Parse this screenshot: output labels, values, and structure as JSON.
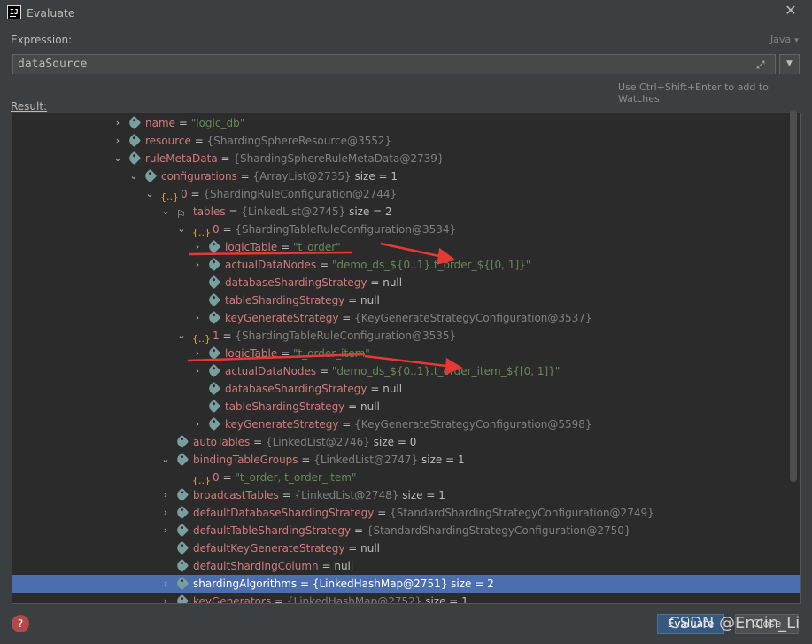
{
  "window": {
    "title": "Evaluate",
    "app_icon_text": "IJ"
  },
  "expression": {
    "label": "Expression:",
    "language": "Java",
    "value": "dataSource",
    "hint": "Use Ctrl+Shift+Enter to add to Watches"
  },
  "result_label": "Result:",
  "tree_rows": [
    {
      "name": "name",
      "eq": " = ",
      "type": "",
      "string": "\"logic_db\"",
      "extra": ""
    },
    {
      "name": "resource",
      "eq": " = ",
      "type": "{ShardingSphereResource@3552}",
      "string": "",
      "extra": ""
    },
    {
      "name": "ruleMetaData",
      "eq": " = ",
      "type": "{ShardingSphereRuleMetaData@2739}",
      "string": "",
      "extra": ""
    },
    {
      "name": "configurations",
      "eq": " = ",
      "type": "{ArrayList@2735}",
      "string": "",
      "extra": "  size = 1"
    },
    {
      "name": "0",
      "eq": " = ",
      "type": "{ShardingRuleConfiguration@2744}",
      "string": "",
      "extra": ""
    },
    {
      "name": "tables",
      "eq": " = ",
      "type": "{LinkedList@2745}",
      "string": "",
      "extra": "  size = 2"
    },
    {
      "name": "0",
      "eq": " = ",
      "type": "{ShardingTableRuleConfiguration@3534}",
      "string": "",
      "extra": ""
    },
    {
      "name": "logicTable",
      "eq": " = ",
      "type": "",
      "string": "\"t_order\"",
      "extra": ""
    },
    {
      "name": "actualDataNodes",
      "eq": " = ",
      "type": "",
      "string": "\"demo_ds_${0..1}.t_order_${[0, 1]}\"",
      "extra": ""
    },
    {
      "name": "databaseShardingStrategy",
      "eq": " = ",
      "type": "",
      "string": "",
      "extra": "null"
    },
    {
      "name": "tableShardingStrategy",
      "eq": " = ",
      "type": "",
      "string": "",
      "extra": "null"
    },
    {
      "name": "keyGenerateStrategy",
      "eq": " = ",
      "type": "{KeyGenerateStrategyConfiguration@3537}",
      "string": "",
      "extra": ""
    },
    {
      "name": "1",
      "eq": " = ",
      "type": "{ShardingTableRuleConfiguration@3535}",
      "string": "",
      "extra": ""
    },
    {
      "name": "logicTable",
      "eq": " = ",
      "type": "",
      "string": "\"t_order_item\"",
      "extra": ""
    },
    {
      "name": "actualDataNodes",
      "eq": " = ",
      "type": "",
      "string": "\"demo_ds_${0..1}.t_order_item_${[0, 1]}\"",
      "extra": ""
    },
    {
      "name": "databaseShardingStrategy",
      "eq": " = ",
      "type": "",
      "string": "",
      "extra": "null"
    },
    {
      "name": "tableShardingStrategy",
      "eq": " = ",
      "type": "",
      "string": "",
      "extra": "null"
    },
    {
      "name": "keyGenerateStrategy",
      "eq": " = ",
      "type": "{KeyGenerateStrategyConfiguration@5598}",
      "string": "",
      "extra": ""
    },
    {
      "name": "autoTables",
      "eq": " = ",
      "type": "{LinkedList@2746}",
      "string": "",
      "extra": "  size = 0"
    },
    {
      "name": "bindingTableGroups",
      "eq": " = ",
      "type": "{LinkedList@2747}",
      "string": "",
      "extra": "  size = 1"
    },
    {
      "name": "0",
      "eq": " = ",
      "type": "",
      "string": "\"t_order, t_order_item\"",
      "extra": ""
    },
    {
      "name": "broadcastTables",
      "eq": " = ",
      "type": "{LinkedList@2748}",
      "string": "",
      "extra": "  size = 1"
    },
    {
      "name": "defaultDatabaseShardingStrategy",
      "eq": " = ",
      "type": "{StandardShardingStrategyConfiguration@2749}",
      "string": "",
      "extra": ""
    },
    {
      "name": "defaultTableShardingStrategy",
      "eq": " = ",
      "type": "{StandardShardingStrategyConfiguration@2750}",
      "string": "",
      "extra": ""
    },
    {
      "name": "defaultKeyGenerateStrategy",
      "eq": " = ",
      "type": "",
      "string": "",
      "extra": "null"
    },
    {
      "name": "defaultShardingColumn",
      "eq": " = ",
      "type": "",
      "string": "",
      "extra": "null"
    },
    {
      "name": "shardingAlgorithms",
      "eq": " = ",
      "type": "{LinkedHashMap@2751}",
      "string": "",
      "extra": "  size = 2"
    },
    {
      "name": "keyGenerators",
      "eq": " = ",
      "type": "{LinkedHashMap@2752}",
      "string": "",
      "extra": "  size = 1"
    }
  ],
  "buttons": {
    "evaluate": "Evaluate",
    "close": "Close",
    "help": "?"
  },
  "watermark": "CSDN @Encin_Li",
  "colors": {
    "selection": "#4b6eaf",
    "annotation": "#e53935",
    "field_name": "#d07b7b",
    "string_value": "#6a8759"
  }
}
